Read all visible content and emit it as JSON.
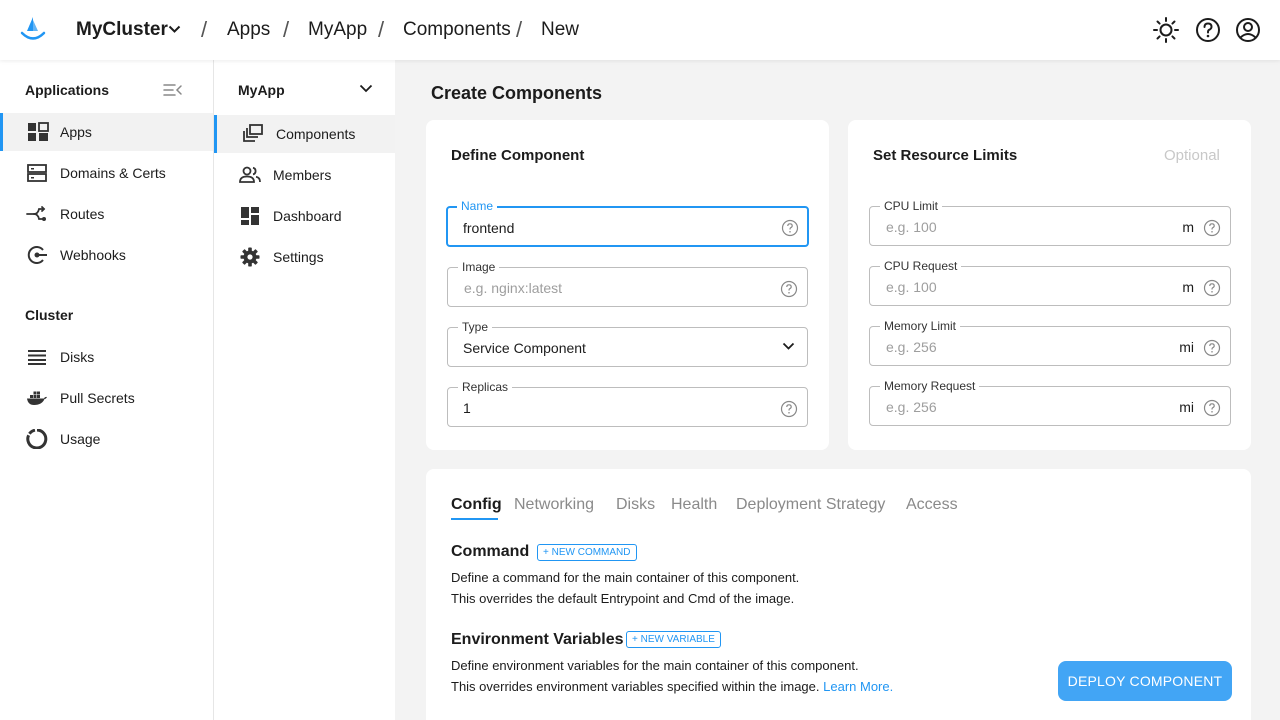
{
  "brand": {
    "accent": "#2196f3"
  },
  "breadcrumb": {
    "cluster": "MyCluster",
    "items": [
      "Apps",
      "MyApp",
      "Components",
      "New"
    ]
  },
  "sidebar": {
    "applications_heading": "Applications",
    "applications": [
      {
        "label": "Apps",
        "icon": "apps-grid-icon",
        "active": true
      },
      {
        "label": "Domains & Certs",
        "icon": "server-icon"
      },
      {
        "label": "Routes",
        "icon": "routes-icon"
      },
      {
        "label": "Webhooks",
        "icon": "webhook-icon"
      }
    ],
    "cluster_heading": "Cluster",
    "cluster": [
      {
        "label": "Disks",
        "icon": "disks-icon"
      },
      {
        "label": "Pull Secrets",
        "icon": "docker-icon"
      },
      {
        "label": "Usage",
        "icon": "usage-donut-icon"
      }
    ]
  },
  "app_nav": {
    "title": "MyApp",
    "items": [
      {
        "label": "Components",
        "icon": "components-icon",
        "active": true
      },
      {
        "label": "Members",
        "icon": "members-icon"
      },
      {
        "label": "Dashboard",
        "icon": "dashboard-icon"
      },
      {
        "label": "Settings",
        "icon": "gear-icon"
      }
    ]
  },
  "page": {
    "title": "Create Components"
  },
  "define": {
    "title": "Define Component",
    "name_label": "Name",
    "name_value": "frontend",
    "image_label": "Image",
    "image_placeholder": "e.g. nginx:latest",
    "type_label": "Type",
    "type_value": "Service Component",
    "replicas_label": "Replicas",
    "replicas_value": "1"
  },
  "limits": {
    "title": "Set Resource Limits",
    "optional": "Optional",
    "cpu_limit_label": "CPU Limit",
    "cpu_limit_placeholder": "e.g. 100",
    "cpu_limit_unit": "m",
    "cpu_request_label": "CPU Request",
    "cpu_request_placeholder": "e.g. 100",
    "cpu_request_unit": "m",
    "mem_limit_label": "Memory Limit",
    "mem_limit_placeholder": "e.g. 256",
    "mem_limit_unit": "mi",
    "mem_request_label": "Memory Request",
    "mem_request_placeholder": "e.g. 256",
    "mem_request_unit": "mi"
  },
  "tabs": [
    "Config",
    "Networking",
    "Disks",
    "Health",
    "Deployment Strategy",
    "Access"
  ],
  "config": {
    "command_title": "Command",
    "command_button": "+ NEW COMMAND",
    "command_desc_1": "Define a command for the main container of this component.",
    "command_desc_2": "This overrides the default Entrypoint and Cmd of the image.",
    "env_title": "Environment Variables",
    "env_button": "+ NEW VARIABLE",
    "env_desc_1": "Define environment variables for the main container of this component.",
    "env_desc_2": "This overrides environment variables specified within the image.",
    "learn_more": "Learn More."
  },
  "deploy_button": "DEPLOY COMPONENT"
}
